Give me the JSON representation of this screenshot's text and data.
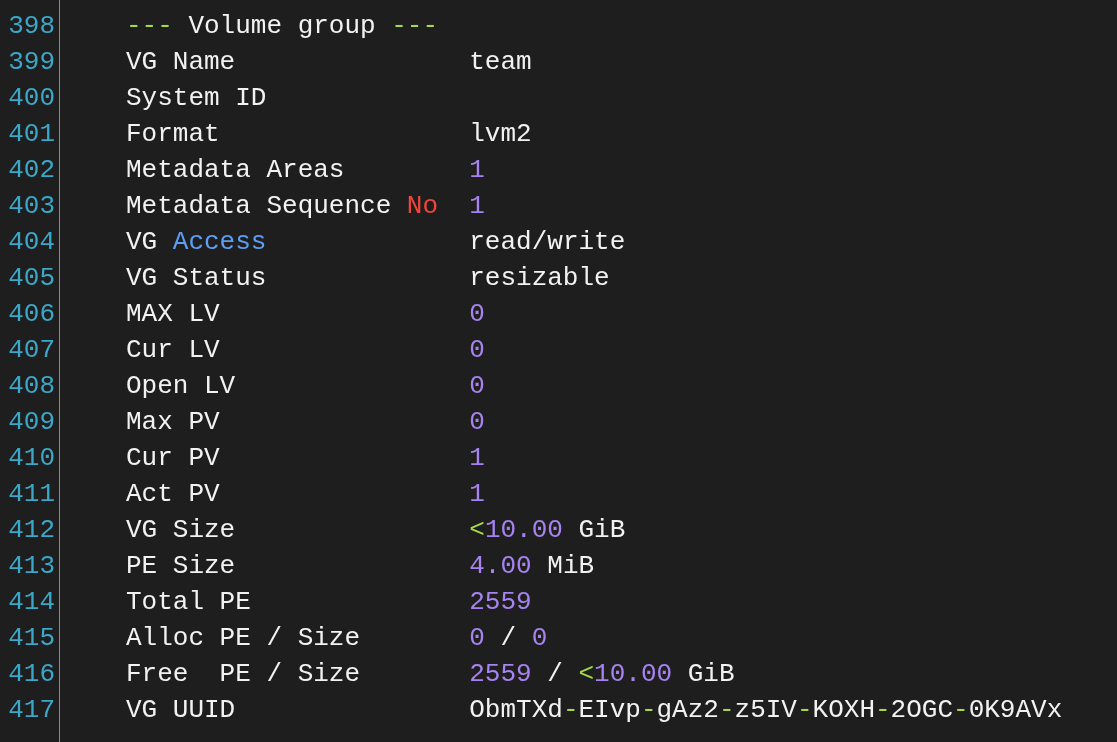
{
  "editor": {
    "lines": [
      {
        "number": "398",
        "segments": [
          {
            "text": "---",
            "kind": "punct"
          },
          {
            "text": " Volume group ",
            "kind": "plain"
          },
          {
            "text": "---",
            "kind": "punct"
          }
        ]
      },
      {
        "number": "399",
        "segments": [
          {
            "text": "VG Name               team",
            "kind": "plain"
          }
        ]
      },
      {
        "number": "400",
        "segments": [
          {
            "text": "System ID",
            "kind": "plain"
          }
        ]
      },
      {
        "number": "401",
        "segments": [
          {
            "text": "Format                lvm2",
            "kind": "plain"
          }
        ]
      },
      {
        "number": "402",
        "segments": [
          {
            "text": "Metadata Areas        ",
            "kind": "plain"
          },
          {
            "text": "1",
            "kind": "number"
          }
        ]
      },
      {
        "number": "403",
        "segments": [
          {
            "text": "Metadata Sequence ",
            "kind": "plain"
          },
          {
            "text": "No",
            "kind": "keyword"
          },
          {
            "text": "  1",
            "kind": "number"
          }
        ]
      },
      {
        "number": "404",
        "segments": [
          {
            "text": "VG ",
            "kind": "plain"
          },
          {
            "text": "Access",
            "kind": "builtin"
          },
          {
            "text": "             read/write",
            "kind": "plain"
          }
        ]
      },
      {
        "number": "405",
        "segments": [
          {
            "text": "VG Status             resizable",
            "kind": "plain"
          }
        ]
      },
      {
        "number": "406",
        "segments": [
          {
            "text": "MAX LV                ",
            "kind": "plain"
          },
          {
            "text": "0",
            "kind": "number"
          }
        ]
      },
      {
        "number": "407",
        "segments": [
          {
            "text": "Cur LV                ",
            "kind": "plain"
          },
          {
            "text": "0",
            "kind": "number"
          }
        ]
      },
      {
        "number": "408",
        "segments": [
          {
            "text": "Open LV               ",
            "kind": "plain"
          },
          {
            "text": "0",
            "kind": "number"
          }
        ]
      },
      {
        "number": "409",
        "segments": [
          {
            "text": "Max PV                ",
            "kind": "plain"
          },
          {
            "text": "0",
            "kind": "number"
          }
        ]
      },
      {
        "number": "410",
        "segments": [
          {
            "text": "Cur PV                ",
            "kind": "plain"
          },
          {
            "text": "1",
            "kind": "number"
          }
        ]
      },
      {
        "number": "411",
        "segments": [
          {
            "text": "Act PV                ",
            "kind": "plain"
          },
          {
            "text": "1",
            "kind": "number"
          }
        ]
      },
      {
        "number": "412",
        "segments": [
          {
            "text": "VG Size               ",
            "kind": "plain"
          },
          {
            "text": "<",
            "kind": "punct"
          },
          {
            "text": "10.00",
            "kind": "number"
          },
          {
            "text": " GiB",
            "kind": "plain"
          }
        ]
      },
      {
        "number": "413",
        "segments": [
          {
            "text": "PE Size               ",
            "kind": "plain"
          },
          {
            "text": "4.00",
            "kind": "number"
          },
          {
            "text": " MiB",
            "kind": "plain"
          }
        ]
      },
      {
        "number": "414",
        "segments": [
          {
            "text": "Total PE              ",
            "kind": "plain"
          },
          {
            "text": "2559",
            "kind": "number"
          }
        ]
      },
      {
        "number": "415",
        "segments": [
          {
            "text": "Alloc PE / Size       ",
            "kind": "plain"
          },
          {
            "text": "0",
            "kind": "number"
          },
          {
            "text": " / ",
            "kind": "plain"
          },
          {
            "text": "0",
            "kind": "number"
          }
        ]
      },
      {
        "number": "416",
        "segments": [
          {
            "text": "Free  PE / Size       ",
            "kind": "plain"
          },
          {
            "text": "2559",
            "kind": "number"
          },
          {
            "text": " / ",
            "kind": "plain"
          },
          {
            "text": "<",
            "kind": "punct"
          },
          {
            "text": "10.00",
            "kind": "number"
          },
          {
            "text": " GiB",
            "kind": "plain"
          }
        ]
      },
      {
        "number": "417",
        "segments": [
          {
            "text": "VG UUID               ObmTXd",
            "kind": "plain"
          },
          {
            "text": "-",
            "kind": "punct"
          },
          {
            "text": "EIvp",
            "kind": "plain"
          },
          {
            "text": "-",
            "kind": "punct"
          },
          {
            "text": "gAz2",
            "kind": "plain"
          },
          {
            "text": "-",
            "kind": "punct"
          },
          {
            "text": "z5IV",
            "kind": "plain"
          },
          {
            "text": "-",
            "kind": "punct"
          },
          {
            "text": "KOXH",
            "kind": "plain"
          },
          {
            "text": "-",
            "kind": "punct"
          },
          {
            "text": "2OGC",
            "kind": "plain"
          },
          {
            "text": "-",
            "kind": "punct"
          },
          {
            "text": "0K9AVx",
            "kind": "plain"
          }
        ]
      }
    ]
  }
}
